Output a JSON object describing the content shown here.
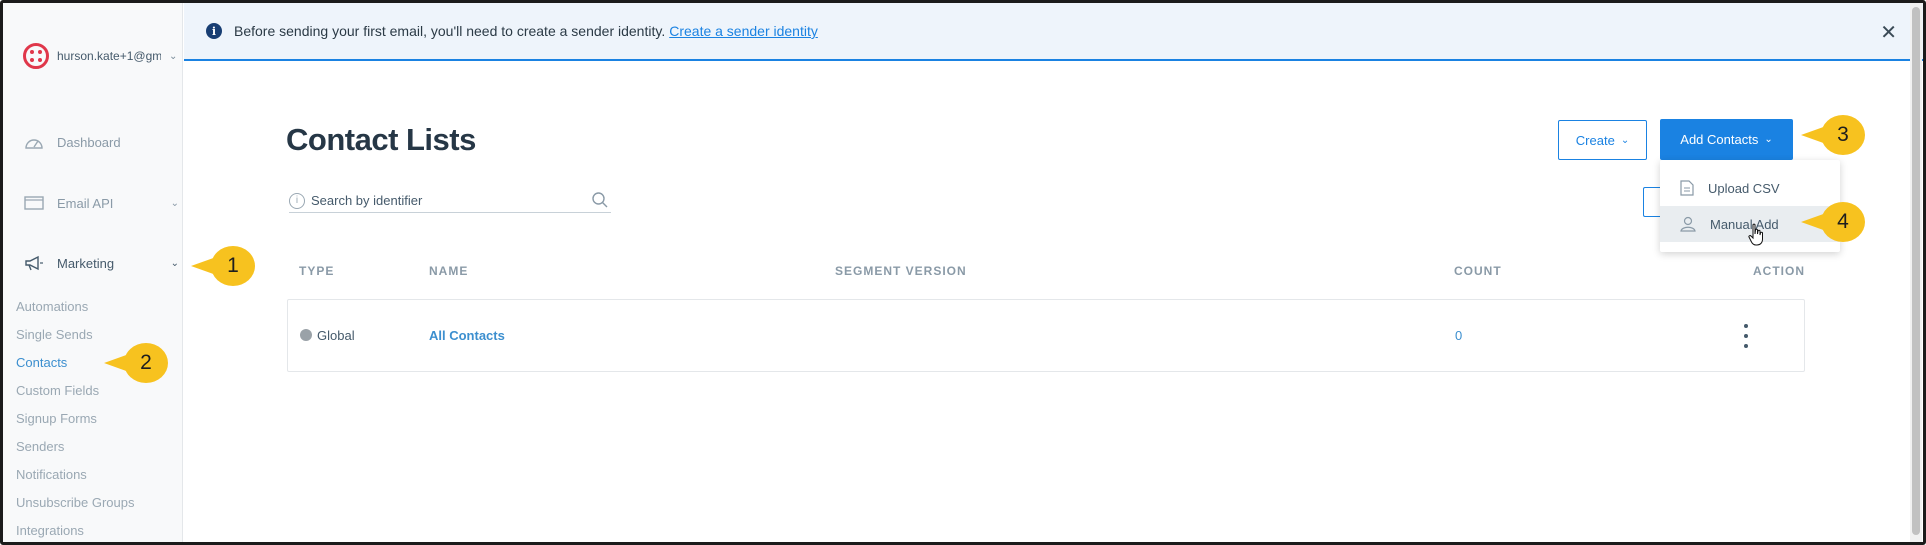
{
  "account": {
    "name": "hurson.kate+1@gm"
  },
  "sidebar": {
    "nav": [
      {
        "label": "Dashboard",
        "icon": "gauge-icon"
      },
      {
        "label": "Email API",
        "icon": "code-window-icon"
      },
      {
        "label": "Marketing",
        "icon": "megaphone-icon"
      }
    ],
    "sub_items": [
      {
        "label": "Automations"
      },
      {
        "label": "Single Sends"
      },
      {
        "label": "Contacts"
      },
      {
        "label": "Custom Fields"
      },
      {
        "label": "Signup Forms"
      },
      {
        "label": "Senders"
      },
      {
        "label": "Notifications"
      },
      {
        "label": "Unsubscribe Groups"
      },
      {
        "label": "Integrations"
      }
    ]
  },
  "banner": {
    "text": "Before sending your first email, you'll need to create a sender identity.",
    "link": "Create a sender identity"
  },
  "main": {
    "title": "Contact Lists",
    "search_placeholder": "Search by identifier",
    "create_label": "Create",
    "add_contacts_label": "Add Contacts",
    "dropdown": [
      {
        "label": "Upload CSV",
        "icon": "document-icon"
      },
      {
        "label": "Manual Add",
        "icon": "person-icon"
      }
    ],
    "table": {
      "headers": [
        "TYPE",
        "NAME",
        "SEGMENT VERSION",
        "COUNT",
        "ACTION"
      ],
      "rows": [
        {
          "type": "Global",
          "name": "All Contacts",
          "segment_version": "",
          "count": "0"
        }
      ]
    }
  },
  "callouts": [
    "1",
    "2",
    "3",
    "4"
  ],
  "colors": {
    "accent": "#1a82e2",
    "callout": "#f7c21f",
    "brand": "#e0374a"
  }
}
